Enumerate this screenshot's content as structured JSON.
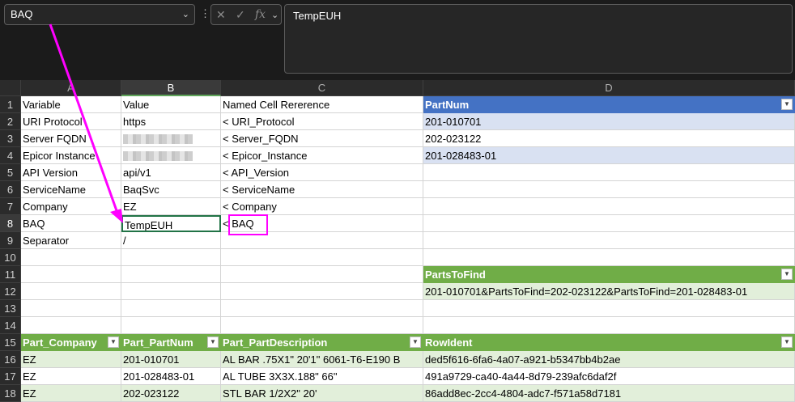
{
  "name_box": "BAQ",
  "formula_bar": {
    "value": "TempEUH",
    "cancel_icon": "x-icon",
    "enter_icon": "check-icon",
    "fx_label": "fx"
  },
  "columns": [
    "A",
    "B",
    "C",
    "D"
  ],
  "rows": [
    "1",
    "2",
    "3",
    "4",
    "5",
    "6",
    "7",
    "8",
    "9",
    "10",
    "11",
    "12",
    "13",
    "14",
    "15",
    "16",
    "17",
    "18"
  ],
  "cells": {
    "A1": "Variable",
    "B1": "Value",
    "C1": "Named Cell Rererence",
    "D1": "PartNum",
    "A2": "URI Protocol",
    "B2": "https",
    "C2": "< URI_Protocol",
    "D2": "201-010701",
    "A3": "Server FQDN",
    "C3": "< Server_FQDN",
    "D3": "202-023122",
    "A4": "Epicor Instance",
    "C4": "< Epicor_Instance",
    "D4": "201-028483-01",
    "A5": "API Version",
    "B5": "api/v1",
    "C5": "< API_Version",
    "A6": "ServiceName",
    "B6": "BaqSvc",
    "C6": "< ServiceName",
    "A7": "Company",
    "B7": "EZ",
    "C7": "< Company",
    "A8": "BAQ",
    "B8": "TempEUH",
    "C8": "< BAQ",
    "A9": "Separator",
    "B9": "/",
    "D11": "PartsToFind",
    "D12": "201-010701&PartsToFind=202-023122&PartsToFind=201-028483-01",
    "A15": "Part_Company",
    "B15": "Part_PartNum",
    "C15": "Part_PartDescription",
    "D15": "RowIdent",
    "A16": "EZ",
    "B16": "201-010701",
    "C16": "AL BAR .75X1\" 20'1\" 6061-T6-E190 B",
    "D16": "ded5f616-6fa6-4a07-a921-b5347bb4b2ae",
    "A17": "EZ",
    "B17": "201-028483-01",
    "C17": "AL TUBE 3X3X.188\" 66\"",
    "D17": "491a9729-ca40-4a44-8d79-239afc6daf2f",
    "A18": "EZ",
    "B18": "202-023122",
    "C18": "STL BAR 1/2X2\" 20'",
    "D18": "86add8ec-2cc4-4804-adc7-f571a58d7181"
  },
  "colors": {
    "blue_header": "#4472c4",
    "blue_band": "#d9e1f2",
    "green_header": "#70ad47",
    "green_band": "#e2efda",
    "annotation": "#ff00ff",
    "active_border": "#217346"
  }
}
